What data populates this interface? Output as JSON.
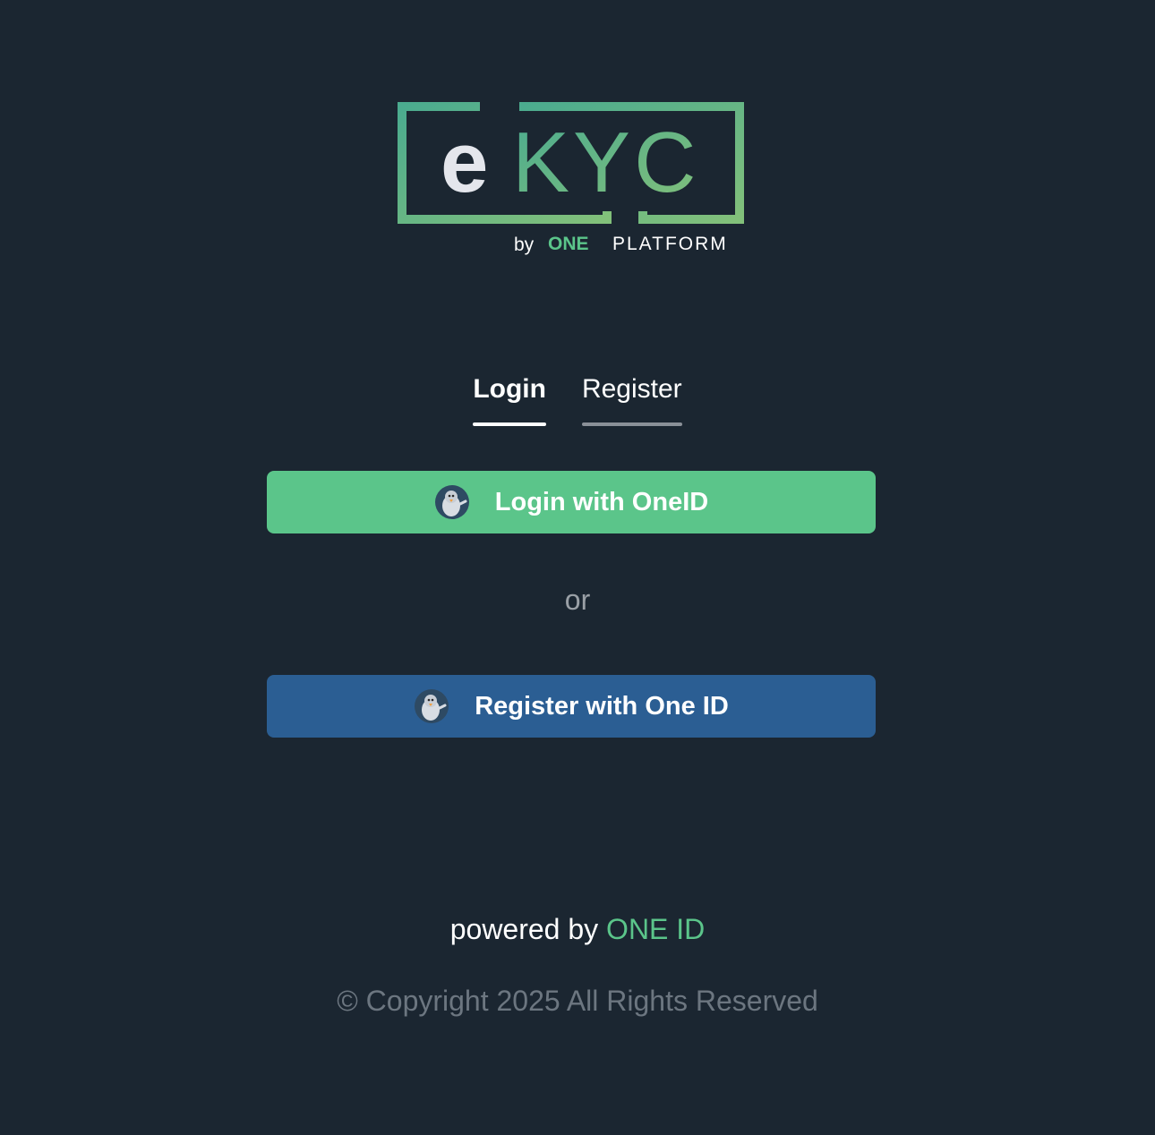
{
  "logo": {
    "wordmark": "eKYC",
    "byline_prefix": "by",
    "byline_brand": "ONE",
    "byline_suffix": "PLATFORM"
  },
  "tabs": [
    {
      "label": "Login",
      "active": true
    },
    {
      "label": "Register",
      "active": false
    }
  ],
  "buttons": {
    "login_label": "Login with OneID",
    "register_label": "Register with One ID"
  },
  "divider_text": "or",
  "footer": {
    "powered_prefix": "powered by",
    "powered_brand": "ONE ID",
    "copyright": "© Copyright 2025 All Rights Reserved"
  },
  "icons": {
    "button_avatar": "penguin-avatar-icon"
  },
  "colors": {
    "background": "#1b2631",
    "accent_green": "#5bc58a",
    "register_blue": "#2b5e93"
  }
}
